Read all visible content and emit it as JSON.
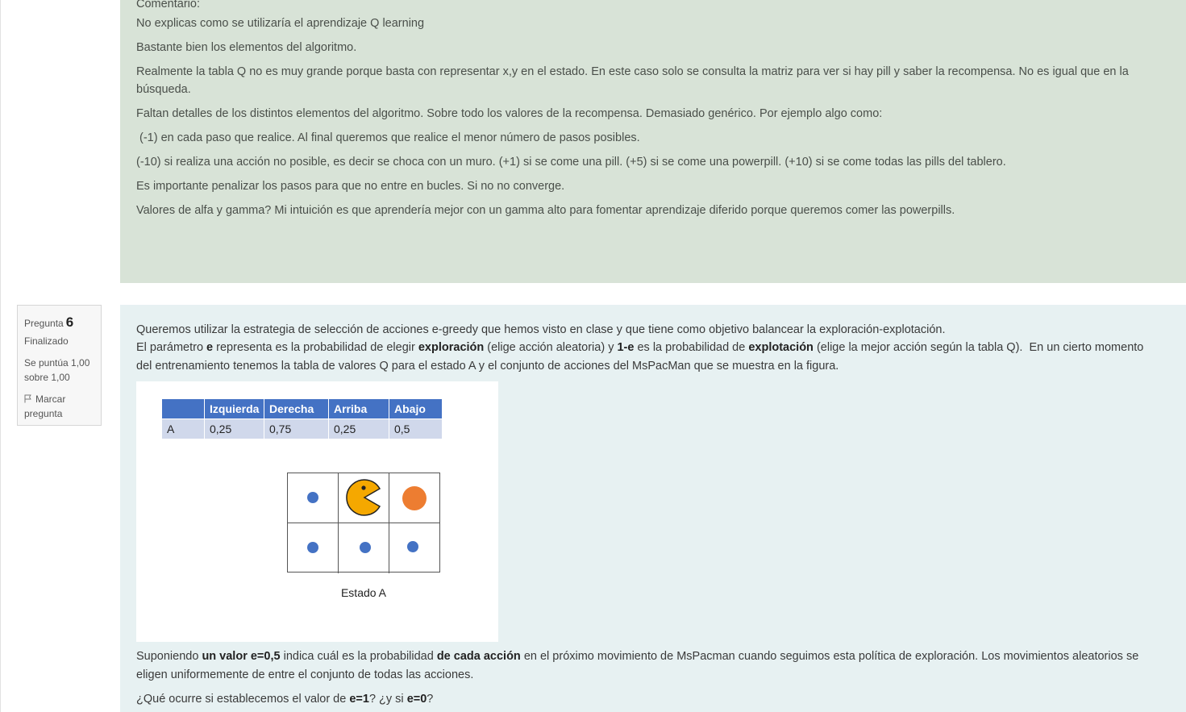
{
  "feedback": {
    "label": "Comentario:",
    "lines": [
      "No explicas como se utilizaría el aprendizaje Q learning",
      "Bastante bien los elementos del algoritmo.",
      "Realmente la tabla Q no es muy grande porque basta con representar x,y en el estado. En este caso solo se consulta la matriz para ver si hay pill y saber la recompensa. No es igual que en la",
      "búsqueda.",
      "Faltan detalles de los distintos elementos del algoritmo. Sobre todo los valores de la recompensa.  Demasiado genérico.  Por ejemplo algo como:",
      " (-1) en cada paso que realice. Al final queremos que realice el menor número de pasos posibles.",
      "(-10) si realiza una acción no posible, es decir se choca con un muro.  (+1) si se come una pill. (+5) si se come una powerpill. (+10) si se come todas las pills del tablero.",
      "Es importante penalizar los pasos para que no entre en bucles. Si no no converge.",
      "Valores de alfa y gamma? Mi intuición es que aprendería mejor con un gamma alto para fomentar aprendizaje diferido porque queremos comer las powerpills."
    ]
  },
  "question_info": {
    "label": "Pregunta",
    "number": "6",
    "state": "Finalizado",
    "grade": "Se puntúa 1,00 sobre 1,00",
    "flag": "Marcar pregunta",
    "flag_icon": "flag-icon"
  },
  "question": {
    "intro_1": "Queremos utilizar la estrategia de selección de acciones e-greedy que hemos visto en clase y que tiene como objetivo balancear la exploración-explotación.",
    "intro_2": {
      "a": "El parámetro ",
      "b": "e",
      "c": " representa es la probabilidad de elegir ",
      "d": "exploración",
      "e": " (elige acción aleatoria) y ",
      "f": "1-e",
      "g": " es la probabilidad de ",
      "h": "explotación",
      "i": " (elige la mejor acción según la tabla Q).  En un cierto momento"
    },
    "intro_3": "del entrenamiento tenemos la tabla de valores Q para el estado A y el conjunto de acciones del MsPacMan que se muestra en la figura.",
    "table": {
      "headers": [
        "",
        "Izquierda",
        "Derecha",
        "Arriba",
        "Abajo"
      ],
      "row": [
        "A",
        "0,25",
        "0,75",
        "0,25",
        "0,5"
      ]
    },
    "grid_caption": "Estado A",
    "grid": [
      [
        "pill",
        "pacman",
        "powerpill"
      ],
      [
        "pill",
        "pill",
        "pill"
      ]
    ],
    "colors": {
      "pill": "#4472c4",
      "powerpill": "#ed7d31",
      "pacman": "#f5a800"
    },
    "outro_1": {
      "a": "Suponiendo ",
      "b": "un valor e=0,5",
      "c": " indica cuál es la probabilidad ",
      "d": "de cada acción",
      "e": " en el próximo movimiento de MsPacman cuando seguimos esta política de exploración. Los movimientos aleatorios se"
    },
    "outro_2": "eligen uniformemente de entre el conjunto de todas las acciones.",
    "outro_3": {
      "a": "¿Qué ocurre si establecemos el valor de ",
      "b": "e=1",
      "c": "? ¿y si ",
      "d": "e=0",
      "e": "?"
    }
  }
}
